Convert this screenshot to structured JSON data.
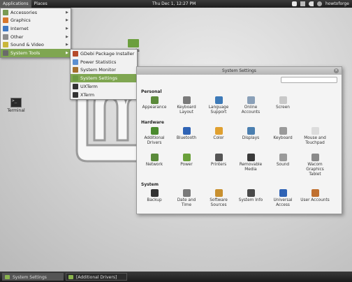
{
  "top_panel": {
    "applications": "Applications",
    "places": "Places",
    "clock": "Thu Dec  1, 12:27 PM",
    "user": "howtoforge"
  },
  "app_menu": {
    "items": [
      {
        "label": "Accessories",
        "color": "#7a9b53"
      },
      {
        "label": "Graphics",
        "color": "#d7772c"
      },
      {
        "label": "Internet",
        "color": "#3f78c2"
      },
      {
        "label": "Other",
        "color": "#8d8d8d"
      },
      {
        "label": "Sound & Video",
        "color": "#c9b63a"
      },
      {
        "label": "System Tools",
        "color": "#6a6a6a"
      }
    ]
  },
  "sub_menu": {
    "items": [
      {
        "label": "GDebi Package Installer",
        "color": "#b54a2a"
      },
      {
        "label": "Power Statistics",
        "color": "#5b8fd1"
      },
      {
        "label": "System Monitor",
        "color": "#a46f2c"
      },
      {
        "label": "System Settings",
        "color": "#6c9a43"
      },
      {
        "label": "UXTerm",
        "color": "#333333"
      },
      {
        "label": "XTerm",
        "color": "#333333"
      }
    ]
  },
  "desktop": {
    "terminal_label": "Terminal",
    "folder_label": "ts"
  },
  "window": {
    "title": "System Settings",
    "sections": {
      "personal": "Personal",
      "hardware": "Hardware",
      "system": "System"
    },
    "personal": [
      {
        "label": "Appearance",
        "color": "#5b8a3a"
      },
      {
        "label": "Keyboard Layout",
        "color": "#7a7a7a"
      },
      {
        "label": "Language Support",
        "color": "#3d7ab8"
      },
      {
        "label": "Online Accounts",
        "color": "#8aa0b8"
      },
      {
        "label": "Screen",
        "color": "#c8c8c8"
      }
    ],
    "hardware1": [
      {
        "label": "Additional Drivers",
        "color": "#4a8a2e"
      },
      {
        "label": "Bluetooth",
        "color": "#2f63b5"
      },
      {
        "label": "Color",
        "color": "#e0a030"
      },
      {
        "label": "Displays",
        "color": "#4b7fb0"
      },
      {
        "label": "Keyboard",
        "color": "#9a9a9a"
      },
      {
        "label": "Mouse and Touchpad",
        "color": "#dcdcdc"
      }
    ],
    "hardware2": [
      {
        "label": "Network",
        "color": "#5a8a3a"
      },
      {
        "label": "Power",
        "color": "#6aa03a"
      },
      {
        "label": "Printers",
        "color": "#555555"
      },
      {
        "label": "Removable Media",
        "color": "#3a3a3a"
      },
      {
        "label": "Sound",
        "color": "#9a9a9a"
      },
      {
        "label": "Wacom Graphics Tablet",
        "color": "#8a8a8a"
      }
    ],
    "system": [
      {
        "label": "Backup",
        "color": "#333333"
      },
      {
        "label": "Date and Time",
        "color": "#7a7a7a"
      },
      {
        "label": "Software Sources",
        "color": "#c89030"
      },
      {
        "label": "System Info",
        "color": "#4a4a4a"
      },
      {
        "label": "Universal Access",
        "color": "#2f63b5"
      },
      {
        "label": "User Accounts",
        "color": "#c07030"
      }
    ]
  },
  "bottom_panel": {
    "tasks": [
      "System Settings",
      "[Additional Drivers]"
    ]
  }
}
